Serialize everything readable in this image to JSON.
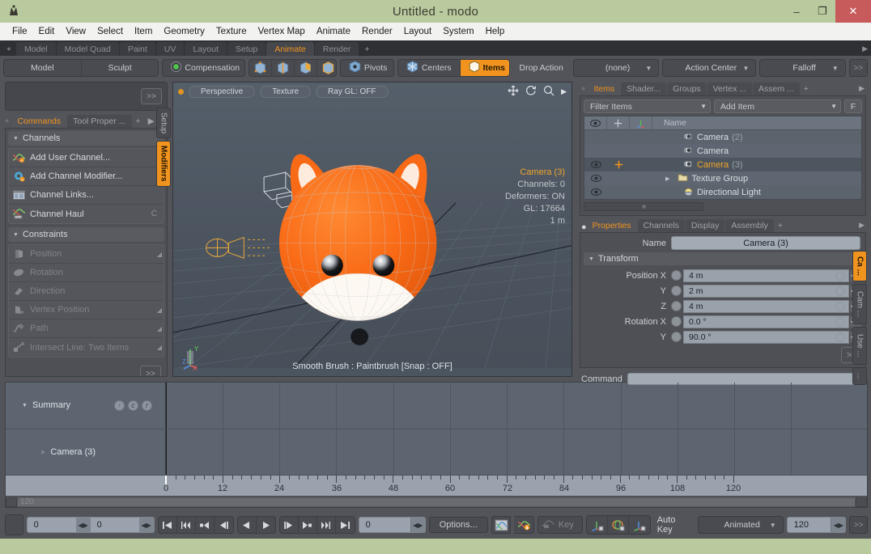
{
  "window": {
    "title": "Untitled - modo",
    "minimize": "–",
    "maximize": "❐",
    "close": "✕"
  },
  "menubar": {
    "items": [
      "File",
      "Edit",
      "View",
      "Select",
      "Item",
      "Geometry",
      "Texture",
      "Vertex Map",
      "Animate",
      "Render",
      "Layout",
      "System",
      "Help"
    ]
  },
  "layout_tabs": {
    "items": [
      "Model",
      "Model Quad",
      "Paint",
      "UV",
      "Layout",
      "Setup",
      "Animate",
      "Render"
    ],
    "selected": "Animate",
    "add": "+",
    "overflow": "▶"
  },
  "modebar": {
    "mode_buttons": [
      "Model",
      "Sculpt"
    ],
    "compensation": "Compensation",
    "pivots": "Pivots",
    "centers": "Centers",
    "items": "Items",
    "drop_action": "Drop Action",
    "none_dropdown": "(none)",
    "action_center": "Action Center",
    "falloff": "Falloff",
    "overflow": ">>"
  },
  "left_panel": {
    "expand": ">>",
    "tabs": [
      "Commands",
      "Tool Proper ..."
    ],
    "selected_tab": "Commands",
    "add_tab": "+",
    "overflow": "▶",
    "sections": [
      {
        "title": "Channels",
        "rows": [
          {
            "label": "Add User Channel...",
            "shortcut": "",
            "dim": false,
            "icon": "channel-curve-icon"
          },
          {
            "label": "Add Channel Modifier...",
            "shortcut": "",
            "dim": false,
            "icon": "gear-icon"
          },
          {
            "label": "Channel Links...",
            "shortcut": "",
            "dim": false,
            "icon": "window-icon"
          },
          {
            "label": "Channel Haul",
            "shortcut": "C",
            "dim": false,
            "icon": "haul-icon"
          }
        ]
      },
      {
        "title": "Constraints",
        "rows": [
          {
            "label": "Position",
            "shortcut": "",
            "dim": true,
            "icon": "position-icon"
          },
          {
            "label": "Rotation",
            "shortcut": "",
            "dim": true,
            "icon": "rotation-icon"
          },
          {
            "label": "Direction",
            "shortcut": "",
            "dim": true,
            "icon": "direction-icon"
          },
          {
            "label": "Vertex Position",
            "shortcut": "",
            "dim": true,
            "icon": "vertex-position-icon"
          },
          {
            "label": "Path",
            "shortcut": "",
            "dim": true,
            "icon": "path-icon"
          },
          {
            "label": "Intersect Line: Two Items",
            "shortcut": "",
            "dim": true,
            "icon": "intersect-icon"
          }
        ]
      }
    ],
    "footer_expand": ">>",
    "vertical_tabs": [
      {
        "label": "Setup",
        "selected": false
      },
      {
        "label": "Modifiers",
        "selected": true
      }
    ]
  },
  "viewport": {
    "view_mode": "Perspective",
    "shading": "Texture",
    "raygl": "Ray GL: OFF",
    "icons": [
      "move-icon",
      "rotate-icon",
      "zoom-icon",
      "chevron-right-icon"
    ],
    "info": {
      "camera": "Camera (3)",
      "channels": "Channels: 0",
      "deformers": "Deformers: ON",
      "gl": "GL: 17664",
      "scale": "1 m"
    },
    "status": "Smooth Brush : Paintbrush  [Snap : OFF]",
    "axis_labels": {
      "x": "X",
      "y": "Y",
      "z": "Z"
    },
    "bg_color": "#4b5560",
    "model_color": "#f96a16"
  },
  "items_panel": {
    "tabs": [
      "Items",
      "Shader...",
      "Groups",
      "Vertex ...",
      "Assem ..."
    ],
    "selected_tab": "Items",
    "add_tab": "+",
    "overflow": "▶",
    "filter_placeholder": "Filter Items",
    "add_item": "Add Item",
    "filter_button": "F",
    "columns": [
      "eye-icon",
      "move-icon",
      "axis-icon",
      "Name"
    ],
    "rows": [
      {
        "name": "Camera",
        "suffix": "(2)",
        "eye": false,
        "xform": false,
        "selected": false,
        "icon": "camera-icon",
        "indent": 2
      },
      {
        "name": "Camera",
        "suffix": "",
        "eye": false,
        "xform": false,
        "selected": false,
        "icon": "camera-icon",
        "indent": 2
      },
      {
        "name": "Camera",
        "suffix": "(3)",
        "eye": true,
        "xform": true,
        "selected": true,
        "icon": "camera-icon",
        "indent": 2
      },
      {
        "name": "Texture Group",
        "suffix": "",
        "eye": true,
        "xform": false,
        "selected": false,
        "icon": "folder-icon",
        "indent": 1,
        "expander": "▶"
      },
      {
        "name": "Directional Light",
        "suffix": "",
        "eye": true,
        "xform": false,
        "selected": false,
        "icon": "light-icon",
        "indent": 2
      }
    ]
  },
  "properties_panel": {
    "tabs": [
      "Properties",
      "Channels",
      "Display",
      "Assembly"
    ],
    "selected_tab": "Properties",
    "add_tab": "+",
    "overflow": "▶",
    "name_label": "Name",
    "name_value": "Camera (3)",
    "transform_header": "Transform",
    "fields": [
      {
        "label": "Position X",
        "value": "4 m"
      },
      {
        "label": "Y",
        "value": "2 m"
      },
      {
        "label": "Z",
        "value": "4 m"
      },
      {
        "label": "Rotation X",
        "value": "0.0 °"
      },
      {
        "label": "Y",
        "value": "90.0 °"
      }
    ],
    "expand": ">>",
    "vertical_tabs": [
      {
        "label": "Ca ...",
        "selected": true
      },
      {
        "label": "Cam ...",
        "selected": false
      },
      {
        "label": "Use ...",
        "selected": false
      },
      {
        "label": "...",
        "selected": false
      }
    ]
  },
  "command_line": {
    "label": "Command",
    "value": ""
  },
  "timeline": {
    "rows": [
      {
        "label": "Summary",
        "badges": [
          "i",
          "c",
          "r"
        ],
        "sub": false
      },
      {
        "label": "Camera (3)",
        "badges": [],
        "sub": true
      }
    ],
    "ruler_labels": [
      "0",
      "12",
      "24",
      "36",
      "48",
      "60",
      "72",
      "84",
      "96",
      "108",
      "120"
    ],
    "frame_start": 0,
    "frame_end": 120,
    "playhead_frame": 0,
    "scroll_label": "120"
  },
  "transport": {
    "field_left": "0",
    "field_right": "0",
    "nav_buttons": [
      "go-to-start-icon",
      "prev-key-icon",
      "prev-frame-step-icon",
      "step-back-icon"
    ],
    "play_buttons": [
      "play-reverse-icon",
      "play-icon"
    ],
    "nav_buttons2": [
      "step-forward-icon",
      "next-key-icon",
      "next-frame-step-icon",
      "go-to-end-icon"
    ],
    "current_frame": "0",
    "options": "Options...",
    "graph_icon": "graph-editor-icon",
    "key_create_icon": "create-key-icon",
    "key_label": "Key",
    "channel_icons": [
      "key-position-icon",
      "key-rotation-icon",
      "key-scale-icon"
    ],
    "auto_key": "Auto Key",
    "mode": "Animated",
    "end_frame": "120",
    "expand": ">>"
  }
}
